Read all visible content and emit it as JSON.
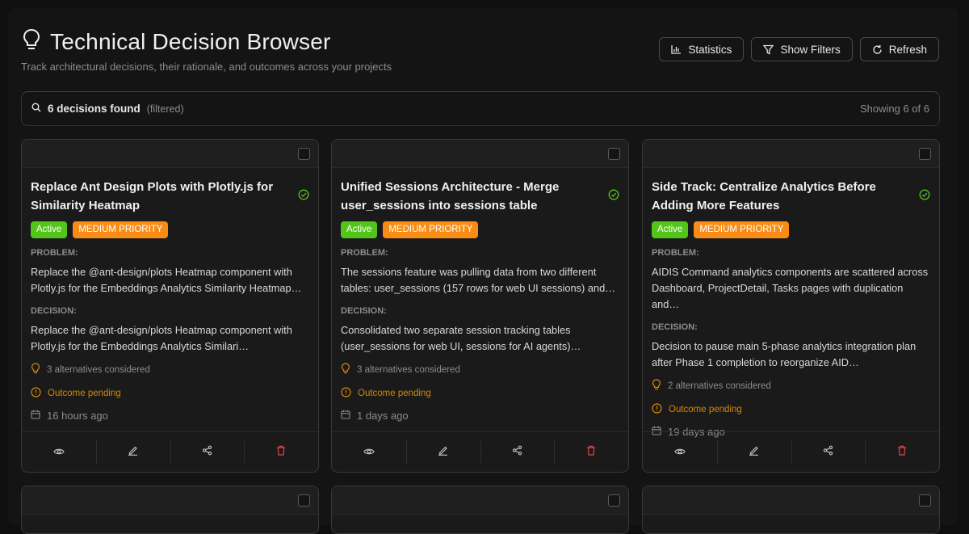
{
  "header": {
    "title": "Technical Decision Browser",
    "subtitle": "Track architectural decisions, their rationale, and outcomes across your projects",
    "title_icon": "lightbulb-icon"
  },
  "toolbar": {
    "statistics_label": "Statistics",
    "filters_label": "Show Filters",
    "refresh_label": "Refresh"
  },
  "results": {
    "found": "6 decisions found",
    "filtered": "(filtered)",
    "showing": "Showing 6 of 6"
  },
  "labels": {
    "problem": "PROBLEM:",
    "decision": "DECISION:"
  },
  "colors": {
    "active": "#52c41a",
    "priority": "#fa8c16",
    "pending": "#d48806",
    "delete": "#e04848"
  },
  "cards": [
    {
      "title": "Replace Ant Design Plots with Plotly.js for Similarity Heatmap",
      "status": "Active",
      "priority": "MEDIUM PRIORITY",
      "problem": "Replace the @ant-design/plots Heatmap component with Plotly.js for the Embeddings Analytics Similarity Heatmap…",
      "decision": "Replace the @ant-design/plots Heatmap component with Plotly.js for the Embeddings Analytics Similari…",
      "alternatives": "3 alternatives considered",
      "outcome": "Outcome pending",
      "date": "16 hours ago"
    },
    {
      "title": "Unified Sessions Architecture - Merge user_sessions into sessions table",
      "status": "Active",
      "priority": "MEDIUM PRIORITY",
      "problem": "The sessions feature was pulling data from two different tables: user_sessions (157 rows for web UI sessions) and…",
      "decision": "Consolidated two separate session tracking tables (user_sessions for web UI, sessions for AI agents)…",
      "alternatives": "3 alternatives considered",
      "outcome": "Outcome pending",
      "date": "1 days ago"
    },
    {
      "title": "Side Track: Centralize Analytics Before Adding More Features",
      "status": "Active",
      "priority": "MEDIUM PRIORITY",
      "problem": "AIDIS Command analytics components are scattered across Dashboard, ProjectDetail, Tasks pages with duplication and…",
      "decision": "Decision to pause main 5-phase analytics integration plan after Phase 1 completion to reorganize AID…",
      "alternatives": "2 alternatives considered",
      "outcome": "Outcome pending",
      "date": "19 days ago"
    }
  ]
}
